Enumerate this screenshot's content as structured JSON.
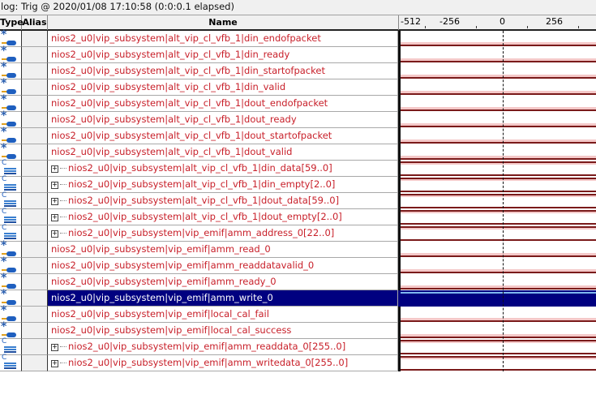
{
  "title": "log: Trig @ 2020/01/08 17:10:58 (0:0:0.1 elapsed)",
  "columns": {
    "type": "Type",
    "alias": "Alias",
    "name": "Name"
  },
  "time_axis": {
    "ticks": [
      "-512",
      "-256",
      "0",
      "256"
    ]
  },
  "selected_row": 16,
  "colors": {
    "signal_text": "#c8202a",
    "selection": "#000080",
    "wave": "#7a1a1a"
  },
  "signals": [
    {
      "name": "nios2_u0|vip_subsystem|alt_vip_cl_vfb_1|din_endofpacket",
      "kind": "bit"
    },
    {
      "name": "nios2_u0|vip_subsystem|alt_vip_cl_vfb_1|din_ready",
      "kind": "bit"
    },
    {
      "name": "nios2_u0|vip_subsystem|alt_vip_cl_vfb_1|din_startofpacket",
      "kind": "bit"
    },
    {
      "name": "nios2_u0|vip_subsystem|alt_vip_cl_vfb_1|din_valid",
      "kind": "bit"
    },
    {
      "name": "nios2_u0|vip_subsystem|alt_vip_cl_vfb_1|dout_endofpacket",
      "kind": "bit"
    },
    {
      "name": "nios2_u0|vip_subsystem|alt_vip_cl_vfb_1|dout_ready",
      "kind": "bit"
    },
    {
      "name": "nios2_u0|vip_subsystem|alt_vip_cl_vfb_1|dout_startofpacket",
      "kind": "bit"
    },
    {
      "name": "nios2_u0|vip_subsystem|alt_vip_cl_vfb_1|dout_valid",
      "kind": "bit"
    },
    {
      "name": "nios2_u0|vip_subsystem|alt_vip_cl_vfb_1|din_data[59..0]",
      "kind": "bus"
    },
    {
      "name": "nios2_u0|vip_subsystem|alt_vip_cl_vfb_1|din_empty[2..0]",
      "kind": "bus"
    },
    {
      "name": "nios2_u0|vip_subsystem|alt_vip_cl_vfb_1|dout_data[59..0]",
      "kind": "bus"
    },
    {
      "name": "nios2_u0|vip_subsystem|alt_vip_cl_vfb_1|dout_empty[2..0]",
      "kind": "bus"
    },
    {
      "name": "nios2_u0|vip_subsystem|vip_emif|amm_address_0[22..0]",
      "kind": "bus"
    },
    {
      "name": "nios2_u0|vip_subsystem|vip_emif|amm_read_0",
      "kind": "bit"
    },
    {
      "name": "nios2_u0|vip_subsystem|vip_emif|amm_readdatavalid_0",
      "kind": "bit"
    },
    {
      "name": "nios2_u0|vip_subsystem|vip_emif|amm_ready_0",
      "kind": "bit"
    },
    {
      "name": "nios2_u0|vip_subsystem|vip_emif|amm_write_0",
      "kind": "bit"
    },
    {
      "name": "nios2_u0|vip_subsystem|vip_emif|local_cal_fail",
      "kind": "bit"
    },
    {
      "name": "nios2_u0|vip_subsystem|vip_emif|local_cal_success",
      "kind": "bit"
    },
    {
      "name": "nios2_u0|vip_subsystem|vip_emif|amm_readdata_0[255..0]",
      "kind": "bus"
    },
    {
      "name": "nios2_u0|vip_subsystem|vip_emif|amm_writedata_0[255..0]",
      "kind": "bus"
    }
  ]
}
